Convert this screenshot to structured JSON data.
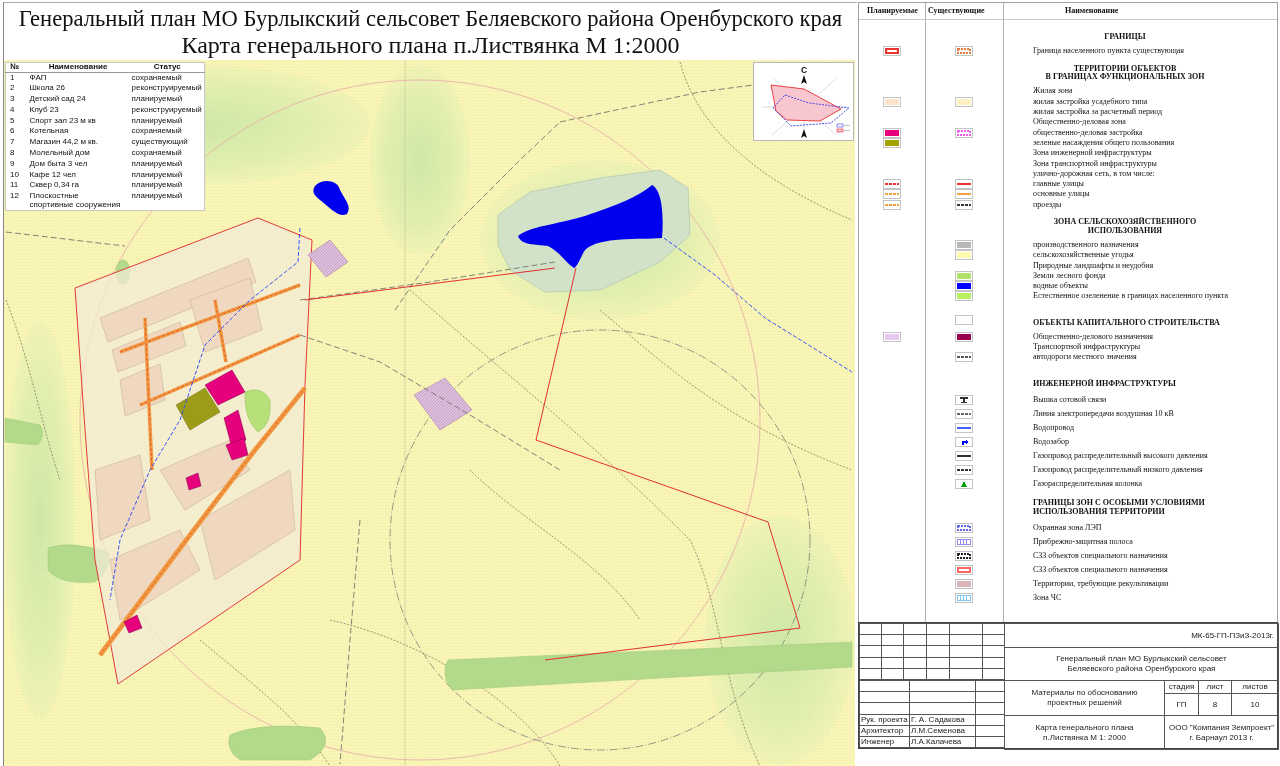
{
  "title": {
    "lines": [
      "Генеральный план МО Бурлыкский сельсовет Беляевского района Оренбурского края",
      "Карта генерального плана п.Листвянка М 1:2000"
    ]
  },
  "objects_table": {
    "columns": [
      "№",
      "Наименование",
      "Статус"
    ],
    "rows": [
      {
        "number": "1",
        "name": "ФАП",
        "status": "сохраняемый"
      },
      {
        "number": "2",
        "name": "Школа 26",
        "status": "реконструируемый"
      },
      {
        "number": "3",
        "name": "Детский сад 24",
        "status": "планируемый"
      },
      {
        "number": "4",
        "name": "Клуб 23",
        "status": "реконструируемый"
      },
      {
        "number": "5",
        "name": "Спорт зал 23 м кв",
        "status": "планируемый"
      },
      {
        "number": "6",
        "name": "Котельная",
        "status": "сохраняемый"
      },
      {
        "number": "7",
        "name": "Магазин 44,2 м кв.",
        "status": "существующий"
      },
      {
        "number": "8",
        "name": "Молельный дом",
        "status": "сохраняемый"
      },
      {
        "number": "9",
        "name": "Дом быта 3 чел",
        "status": "планируемый"
      },
      {
        "number": "10",
        "name": "Кафе 12 чел",
        "status": "планируемый"
      },
      {
        "number": "11",
        "name": "Сквер 0,34 га",
        "status": "планируемый"
      },
      {
        "number": "12",
        "name": "Плоскостные спортивные сооружения",
        "status": "планируемый"
      }
    ]
  },
  "map": {
    "wind_rose": {
      "north_label": "С"
    }
  },
  "legend": {
    "columns": [
      "Планируемые",
      "Существующие",
      "Наименование"
    ],
    "sections": [
      {
        "kind": "section",
        "heading": [
          "ГРАНИЦЫ"
        ],
        "items": [
          {
            "label": "Граница населенного пункта существующая",
            "planned": {
              "kind": "outline",
              "color": "#ee3333"
            },
            "existing": {
              "kind": "dashed_outline",
              "color": "#e07a3a"
            }
          }
        ]
      },
      {
        "kind": "section",
        "heading": [
          "ТЕРРИТОРИИ ОБЪЕКТОВ",
          "В ГРАНИЦАХ ФУНКЦИОНАЛЬНЫХ ЗОН"
        ],
        "items": [
          {
            "label": "Жилая зона"
          },
          {
            "label": "жилая застройка усадебного типа",
            "planned": {
              "kind": "fill",
              "color": "#fde4c8"
            },
            "existing": {
              "kind": "fill",
              "color": "#fbf1c2"
            }
          },
          {
            "label": "жилая застройка за расчетный период"
          },
          {
            "label": "Общественно-деловая зона"
          },
          {
            "label": "общественно-деловая застройка",
            "planned": {
              "kind": "fill",
              "color": "#e8007a"
            },
            "existing": {
              "kind": "dashed_outline",
              "color": "#f060f0"
            }
          },
          {
            "label": "зеленые насаждения общего пользования",
            "planned": {
              "kind": "fill",
              "color": "#a3a300"
            }
          },
          {
            "label": "Зона инженерной инфраструктуры"
          },
          {
            "label": "Зона транспортной инфраструктуры"
          },
          {
            "label": "улично-дорожная сеть, в том числе:"
          },
          {
            "label": "главные улицы",
            "planned": {
              "kind": "dashed_line",
              "color": "#ee3333"
            },
            "existing": {
              "kind": "line",
              "color": "#ee3333"
            }
          },
          {
            "label": "основные улицы",
            "planned": {
              "kind": "dashed_line",
              "color": "#f0a040"
            },
            "existing": {
              "kind": "line",
              "color": "#f0a040"
            }
          },
          {
            "label": "проезды",
            "planned": {
              "kind": "dashed_line",
              "color": "#f0a040"
            },
            "existing": {
              "kind": "dashed_line",
              "color": "#333333"
            }
          }
        ]
      },
      {
        "kind": "section",
        "heading": [
          "ЗОНА СЕЛЬСКОХОЗЯЙСТВЕННОГО",
          "ИСПОЛЬЗОВАНИЯ"
        ],
        "items": [
          {
            "label": "производственного назначения",
            "existing": {
              "kind": "fill",
              "color": "#b8b8b8"
            }
          },
          {
            "label": "сельскохозяйственные угодья",
            "existing": {
              "kind": "fill",
              "color": "#fdfcb0"
            }
          },
          {
            "label": "Природные ландшафты и неудобия"
          },
          {
            "label": "Земли лесного фонда",
            "existing": {
              "kind": "fill",
              "color": "#b4e06c"
            }
          },
          {
            "label": "водные объекты",
            "existing": {
              "kind": "fill",
              "color": "#0000ff"
            }
          },
          {
            "label": "Естественное озеленение в границах населенного пункта",
            "existing": {
              "kind": "fill",
              "color": "#b8f060"
            }
          }
        ]
      },
      {
        "kind": "section",
        "heading": [
          "ОБЪЕКТЫ КАПИТАЛЬНОГО СТРОИТЕЛЬСТВА"
        ],
        "existing": {
          "kind": "blank"
        },
        "items": [
          {
            "label": "Общественно-делового назначения",
            "planned": {
              "kind": "fill",
              "color": "#e6c8f2"
            },
            "existing": {
              "kind": "fill",
              "color": "#990050"
            }
          },
          {
            "label": "Транспортной инфраструктуры"
          },
          {
            "label": "автодороги местного значения",
            "existing": {
              "kind": "dashed_line",
              "color": "#555555"
            }
          }
        ]
      },
      {
        "kind": "subsection",
        "heading": [
          "ИНЖЕНЕРНОЙ ИНФРАСТРУКТУРЫ"
        ],
        "items": [
          {
            "label": "Вышка сотовой связи",
            "existing": {
              "kind": "tower",
              "color": "#333333"
            }
          },
          {
            "label": "Линия электропередачи воздушная 10 кВ",
            "existing": {
              "kind": "dashed_line",
              "color": "#666666"
            }
          },
          {
            "label": "Водопровод",
            "existing": {
              "kind": "line",
              "color": "#4060ff"
            }
          },
          {
            "label": "Водозабор",
            "existing": {
              "kind": "hook",
              "color": "#0000ff"
            }
          },
          {
            "label": "Газопровод распределительный высокого давления",
            "existing": {
              "kind": "line",
              "color": "#333333"
            }
          },
          {
            "label": "Газопровод распределительный низкого давления",
            "existing": {
              "kind": "dashed_line",
              "color": "#333333"
            }
          },
          {
            "label": "Газораспределительная колонка",
            "existing": {
              "kind": "triangle",
              "color": "#00a000"
            }
          }
        ]
      },
      {
        "kind": "subsection",
        "heading": [
          "ГРАНИЦЫ ЗОН С ОСОБЫМИ УСЛОВИЯМИ",
          "ИСПОЛЬЗОВАНИЯ ТЕРРИТОРИИ"
        ],
        "items": [
          {
            "label": "Охранная зона ЛЭП",
            "existing": {
              "kind": "dashed_outline",
              "color": "#6464e6"
            }
          },
          {
            "label": "Прибрежно-защитная полоса",
            "existing": {
              "kind": "hatch",
              "color": "#8c8cf0"
            }
          },
          {
            "label": "СЗЗ объектов специального назначения",
            "existing": {
              "kind": "dashed_outline",
              "color": "#222222"
            }
          },
          {
            "label": "СЗЗ объектов специального назначения",
            "existing": {
              "kind": "outline",
              "color": "#ff6666"
            }
          },
          {
            "label": "Территории, требующие рекультивации",
            "existing": {
              "kind": "fill",
              "color": "#d9b3b8"
            }
          },
          {
            "label": "Зона ЧС",
            "existing": {
              "kind": "hatch",
              "color": "#80c8f0"
            }
          }
        ]
      }
    ]
  },
  "title_block": {
    "code": "МК-65-ГП-ПЗиЗ-2013г.",
    "project_lines": [
      "Генеральный план МО Бурлыкский сельсовет",
      "Беляевского района Оренбурского края"
    ],
    "document_lines": [
      "Материалы по обоснованию",
      "проектных решений"
    ],
    "stage_headers": [
      "стадия",
      "лист",
      "листов"
    ],
    "stage_values": [
      "ГП",
      "8",
      "10"
    ],
    "sheet_lines": [
      "Карта генерального плана",
      "п.Листвянка М 1: 2000"
    ],
    "company_lines": [
      "ООО \"Компания Земпроект\"",
      "г. Барнаул 2013 г."
    ],
    "signatures": [
      {
        "role": "Рук. проекта",
        "name": "Г. А. Садакова"
      },
      {
        "role": "Архитектор",
        "name": "Л.М.Семенова"
      },
      {
        "role": "Инженер",
        "name": "Л.А.Калачева"
      }
    ]
  }
}
